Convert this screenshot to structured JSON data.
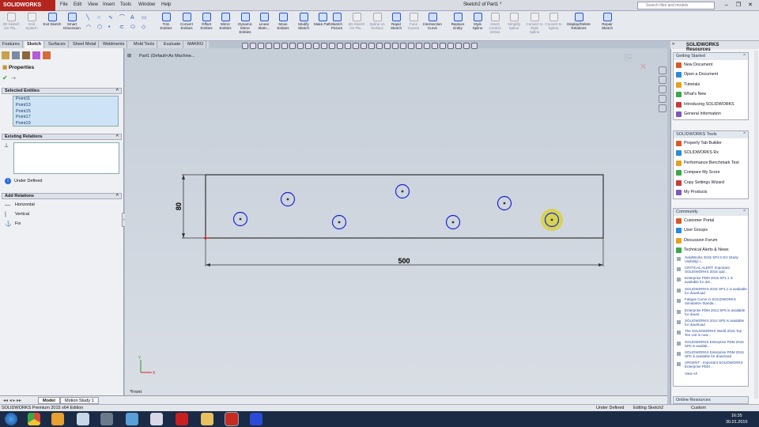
{
  "app": {
    "logo": "SOLIDWORKS",
    "menu": [
      "File",
      "Edit",
      "View",
      "Insert",
      "Tools",
      "Window",
      "Help"
    ],
    "document_title": "Sketch2 of Part1 *",
    "search_placeholder": "Search files and models"
  },
  "ribbon": {
    "buttons": [
      {
        "label": "3D Sketch On Pla...",
        "dim": true
      },
      {
        "label": "Grid System",
        "dim": true
      },
      {
        "label": "Exit Sketch",
        "dim": false
      },
      {
        "label": "Smart Dimension",
        "dim": false
      },
      {
        "label": "Trim Entities",
        "dim": false
      },
      {
        "label": "Convert Entities",
        "dim": false
      },
      {
        "label": "Offset Entities",
        "dim": false
      },
      {
        "label": "Mirror Entities",
        "dim": false
      },
      {
        "label": "Dynamic Mirror Entities",
        "dim": false
      },
      {
        "label": "Linear Sketc...",
        "dim": false
      },
      {
        "label": "Move Entities",
        "dim": false
      },
      {
        "label": "Modify Sketch",
        "dim": false
      },
      {
        "label": "Make Path",
        "dim": false
      },
      {
        "label": "Sketch Picture",
        "dim": false
      },
      {
        "label": "3D Sketch On Pla...",
        "dim": true
      },
      {
        "label": "Spline on Surface",
        "dim": true
      },
      {
        "label": "Rapid Sketch",
        "dim": false
      },
      {
        "label": "Face Curves",
        "dim": true
      },
      {
        "label": "Intersection Curve",
        "dim": false
      },
      {
        "label": "Replace Entity",
        "dim": false
      },
      {
        "label": "Style Spline",
        "dim": false
      },
      {
        "label": "Insert Control Vertex",
        "dim": true
      },
      {
        "label": "Simplify Spline",
        "dim": true
      },
      {
        "label": "Convert to Style Spline",
        "dim": true
      },
      {
        "label": "Convert to Spline",
        "dim": true
      },
      {
        "label": "Display/Delete Relations",
        "dim": false
      },
      {
        "label": "Repair Sketch",
        "dim": false
      }
    ]
  },
  "tabs": [
    "Features",
    "Sketch",
    "Surfaces",
    "Sheet Metal",
    "Weldments",
    "Mold Tools",
    "Evaluate",
    "MAKRO"
  ],
  "active_tab": "Sketch",
  "property_manager": {
    "title": "Properties",
    "selected_entities_title": "Selected Entities",
    "selected_entities": [
      "Point11",
      "Point13",
      "Point15",
      "Point17",
      "Point19"
    ],
    "existing_relations_title": "Existing Relations",
    "status": "Under Defined",
    "add_relations_title": "Add Relations",
    "add_relations": [
      {
        "label": "Horizontal",
        "icon": "horizontal-icon"
      },
      {
        "label": "Vertical",
        "icon": "vertical-icon"
      },
      {
        "label": "Fix",
        "icon": "fix-icon"
      }
    ]
  },
  "graphics": {
    "tree_label": "Part1 (Default<As Machine...",
    "view_label": "*Front",
    "dim_width": "500",
    "dim_height": "80"
  },
  "task_pane": {
    "title": "SOLIDWORKS Resources",
    "getting_started": {
      "title": "Getting Started",
      "items": [
        "New Document",
        "Open a Document",
        "Tutorials",
        "What's New",
        "Introducing SOLIDWORKS",
        "General Information"
      ]
    },
    "tools": {
      "title": "SOLIDWORKS Tools",
      "items": [
        "Property Tab Builder",
        "SOLIDWORKS Rx",
        "Performance Benchmark Test",
        "Compare My Score",
        "Copy Settings Wizard",
        "My Products"
      ]
    },
    "community": {
      "title": "Community",
      "items": [
        "Customer Portal",
        "User Groups",
        "Discussion Forum",
        "Technical Alerts & News"
      ],
      "news": [
        "SolidWorks 2015 SP2.0 EV (Early Visibility) i...",
        "CRITICAL ALERT: Important SOLIDWORKS 2015 upd...",
        "Enterprise PDM 2015 SP1.1 is available for dol...",
        "SOLIDWORKS 2015 SP1.1 is available for download",
        "Fatigue Curve in SOLIDWORKS Simulation Standa...",
        "Enterprise PDM 2014 SP5 is available for downl...",
        "SOLIDWORKS 2014 SP5 is available for download",
        "The SOLIDWORKS World 2015 Top Ten List is now...",
        "SOLIDWORKS Enterprise PDM 2015 SP0 is availab...",
        "SOLIDWORKS Enterprise PDM 2015 SP0 is available for download",
        "URGENT - Important SOLIDWORKS Enterprise PDM ..."
      ],
      "view_all": "View All"
    },
    "online_resources": "Online Resources"
  },
  "model_tabs": [
    "Model",
    "Motion Study 1"
  ],
  "status": {
    "edition": "SOLIDWORKS Premium 2015 x64 Edition",
    "defined": "Under Defined",
    "editing": "Editing Sketch2",
    "units": "Custom"
  },
  "clock": {
    "time": "16:35",
    "date": "30.01.2015"
  },
  "colors": {
    "brand": "#b3261e",
    "sketch_line": "#111111",
    "circle": "#1a24d8",
    "highlight": "#d8d23a"
  }
}
